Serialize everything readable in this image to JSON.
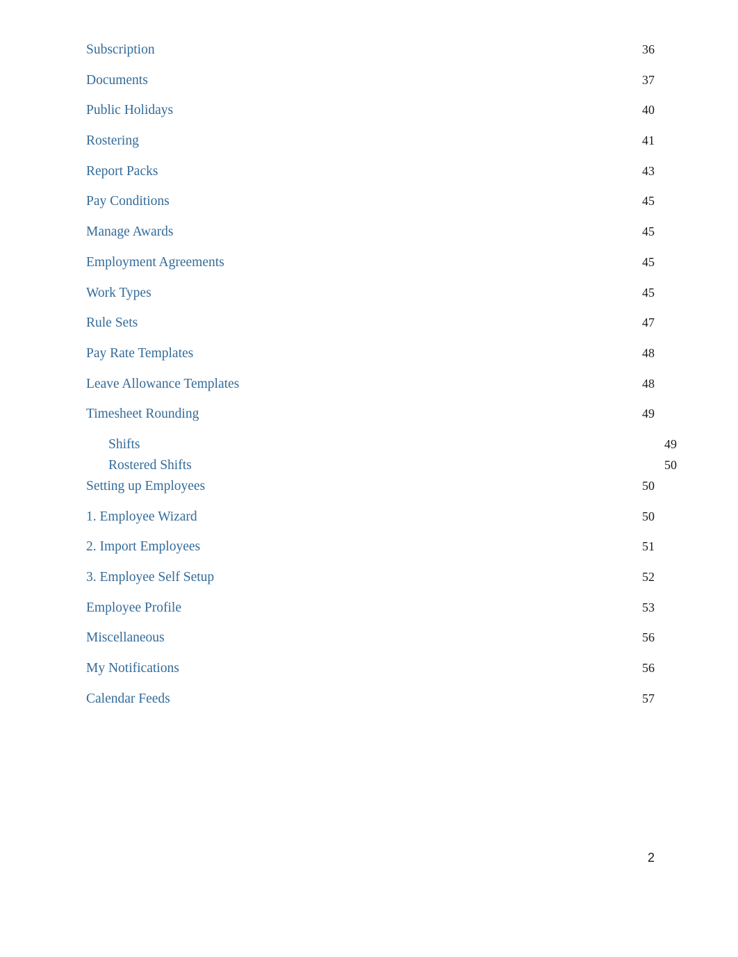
{
  "document": {
    "footer_page_number": "2",
    "link_color": "#336b99",
    "page_number_color": "#1a1a1a"
  },
  "toc": {
    "entries": [
      {
        "label": "Subscription",
        "page": "36",
        "level": 1
      },
      {
        "label": "Documents",
        "page": "37",
        "level": 1
      },
      {
        "label": "Public Holidays",
        "page": "40",
        "level": 1
      },
      {
        "label": "Rostering",
        "page": "41",
        "level": 1
      },
      {
        "label": "Report Packs",
        "page": "43",
        "level": 1
      },
      {
        "label": "Pay Conditions",
        "page": "45",
        "level": 1
      },
      {
        "label": "Manage Awards",
        "page": "45",
        "level": 1
      },
      {
        "label": "Employment Agreements",
        "page": "45",
        "level": 1
      },
      {
        "label": "Work Types",
        "page": "45",
        "level": 1
      },
      {
        "label": "Rule Sets",
        "page": "47",
        "level": 1
      },
      {
        "label": "Pay Rate Templates",
        "page": "48",
        "level": 1
      },
      {
        "label": "Leave Allowance Templates",
        "page": "48",
        "level": 1
      },
      {
        "label": "Timesheet Rounding",
        "page": "49",
        "level": 1
      },
      {
        "label": "Shifts",
        "page": "49",
        "level": 2
      },
      {
        "label": "Rostered Shifts",
        "page": "50",
        "level": 2
      },
      {
        "label": "Setting up Employees",
        "page": "50",
        "level": 1
      },
      {
        "label": "1. Employee Wizard",
        "page": "50",
        "level": 1
      },
      {
        "label": "2. Import Employees",
        "page": "51",
        "level": 1
      },
      {
        "label": "3. Employee Self Setup",
        "page": "52",
        "level": 1
      },
      {
        "label": "Employee Profile",
        "page": "53",
        "level": 1
      },
      {
        "label": "Miscellaneous",
        "page": "56",
        "level": 1
      },
      {
        "label": "My Notifications",
        "page": "56",
        "level": 1
      },
      {
        "label": "Calendar Feeds",
        "page": "57",
        "level": 1
      }
    ]
  }
}
